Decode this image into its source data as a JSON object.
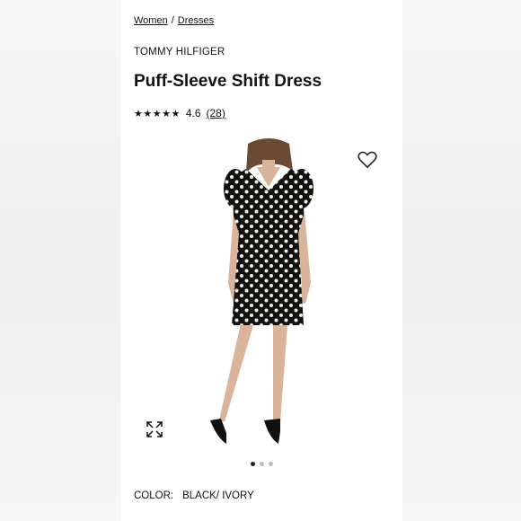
{
  "breadcrumb": {
    "items": [
      {
        "label": "Women"
      },
      {
        "label": "Dresses"
      }
    ],
    "separator": "/"
  },
  "product": {
    "brand": "TOMMY HILFIGER",
    "title": "Puff-Sleeve Shift Dress",
    "rating": {
      "stars_display": "★★★★★",
      "value": 4.6,
      "value_text": "4.6",
      "count_text": "(28)"
    },
    "image": {
      "icon_favorite": "heart-icon",
      "icon_expand": "expand-icon",
      "carousel_total": 3,
      "carousel_active": 1
    },
    "color": {
      "label": "COLOR:",
      "value": "BLACK/ IVORY"
    }
  },
  "colors": {
    "dress": "#111111",
    "dots": "#f3efe6",
    "skin": "#d9b49a",
    "hair": "#6b4a33"
  }
}
